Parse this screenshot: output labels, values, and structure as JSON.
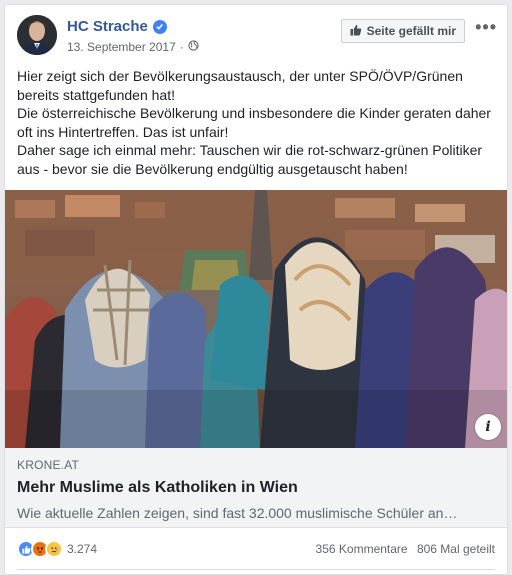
{
  "post": {
    "author": "HC Strache",
    "date": "13. September 2017",
    "like_page_label": "Seite gefällt mir",
    "text_lines": [
      "Hier zeigt sich der Bevölkerungsaustausch, der unter SPÖ/ÖVP/Grünen bereits stattgefunden hat!",
      "Die österreichische Bevölkerung und insbesondere die Kinder geraten daher oft ins Hintertreffen. Das ist unfair!",
      "Daher sage ich einmal mehr: Tauschen wir die rot-schwarz-grünen Politiker aus - bevor sie die Bevölkerung endgültig ausgetauscht haben!"
    ]
  },
  "link": {
    "domain": "KRONE.AT",
    "title": "Mehr Muslime als Katholiken in Wien",
    "description": "Wie aktuelle Zahlen zeigen, sind fast 32.000 muslimische Schüler an…"
  },
  "footer": {
    "reaction_count": "3.274",
    "comments": "356 Kommentare",
    "shares": "806 Mal geteilt"
  },
  "colors": {
    "link_blue": "#365899",
    "verified_blue": "#4080ff",
    "like_blue": "#4a8cf7",
    "angry_orange": "#e9710f",
    "sad_yellow": "#f7c53f"
  },
  "icons": [
    "verified-icon",
    "globe-icon",
    "thumbs-up-icon",
    "more-icon",
    "info-icon",
    "like-reaction-icon",
    "angry-reaction-icon",
    "sad-reaction-icon"
  ]
}
